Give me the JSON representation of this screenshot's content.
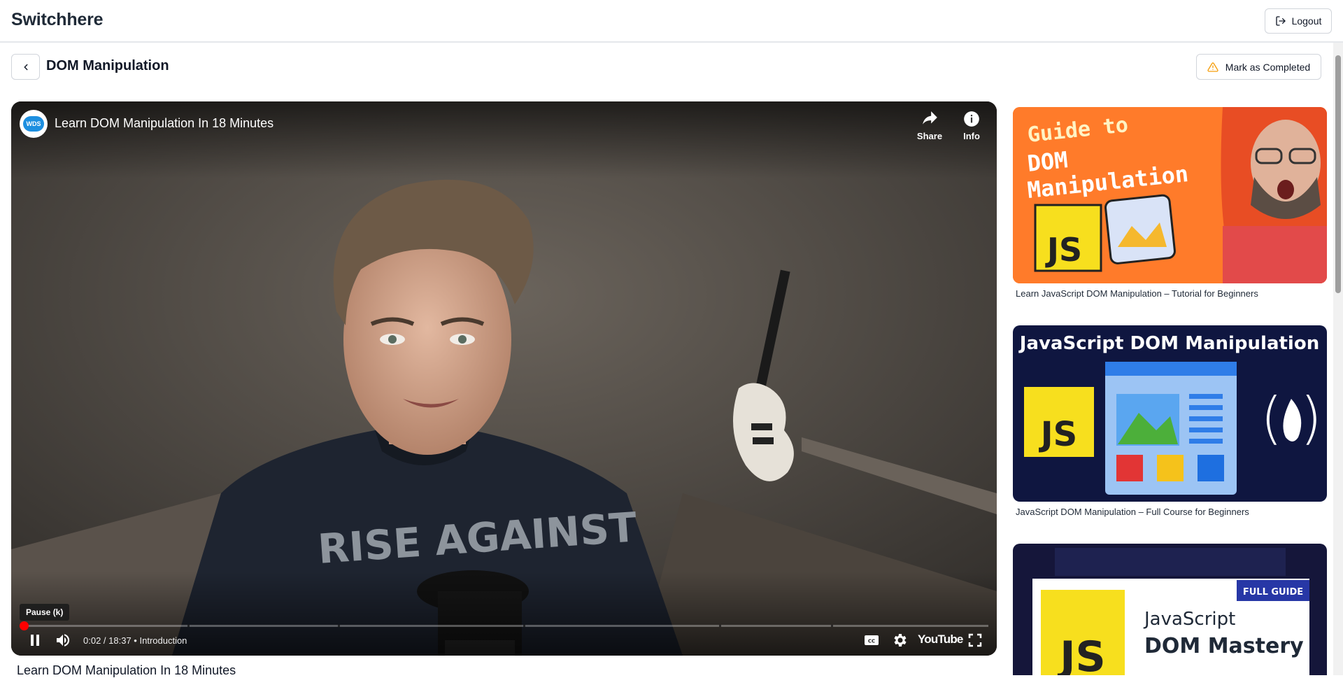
{
  "app": {
    "brand": "Switchhere",
    "logout_label": "Logout"
  },
  "page": {
    "title": "DOM Manipulation",
    "complete_label": "Mark as Completed"
  },
  "player": {
    "video_title": "Learn DOM Manipulation In 18 Minutes",
    "channel_initials": "WDS",
    "share_label": "Share",
    "info_label": "Info",
    "tooltip": "Pause (k)",
    "time": "0:02 / 18:37",
    "separator": "•",
    "chapter": "Introduction",
    "brand": "YouTube",
    "progress_fraction": 0.002,
    "shirt_text": "RISE AGAINST"
  },
  "below_title": "Learn DOM Manipulation In 18 Minutes",
  "related": [
    {
      "caption": "Learn JavaScript DOM Manipulation – Tutorial for Beginners",
      "thumb_line1": "Guide to",
      "thumb_line2": "DOM",
      "thumb_line3": "Manipulation",
      "thumb_js": "JS"
    },
    {
      "caption": "JavaScript DOM Manipulation – Full Course for Beginners",
      "thumb_title": "JavaScript DOM Manipulation",
      "thumb_js": "JS"
    },
    {
      "thumb_badge": "FULL GUIDE",
      "thumb_line1": "JavaScript",
      "thumb_line2": "DOM Mastery",
      "thumb_js": "JS"
    }
  ],
  "colors": {
    "progress": "#ff0000",
    "warning": "#f59e0b",
    "thumb1_bg": "#ff6a1a",
    "thumb2_bg": "#0f1640",
    "js_yellow": "#f7df1e"
  }
}
